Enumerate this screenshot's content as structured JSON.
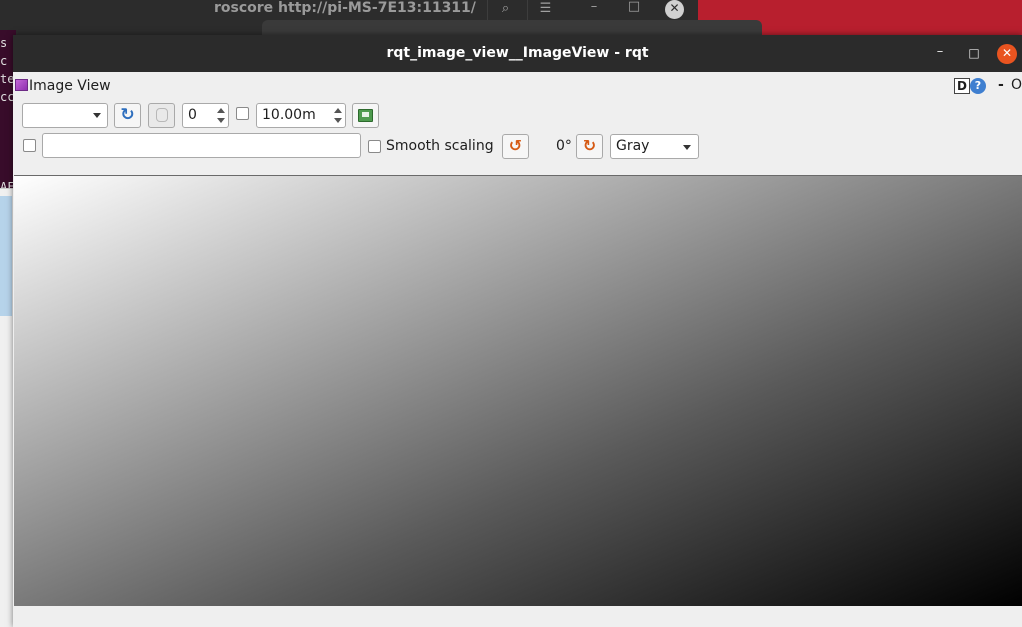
{
  "background_window": {
    "title": "roscore http://pi-MS-7E13:11311/",
    "search_icon": "search-icon",
    "menu_icon": "hamburger-menu-icon",
    "terminal_text": "s\nc\nte\ncc\n\n\n\n\nAF"
  },
  "window": {
    "title": "rqt_image_view__ImageView - rqt",
    "controls": {
      "minimize": "–",
      "maximize": "□",
      "close": "✕"
    }
  },
  "dock": {
    "title": "Image View",
    "help_d": "D",
    "help_q": "?",
    "dash": "-",
    "close_partial": "O"
  },
  "toolbar": {
    "topic_combo_value": "",
    "refresh_glyph": "↻",
    "index_value": "0",
    "timeout_checked": false,
    "timeout_value": "10.00m",
    "topic_checked": false,
    "topic_text_value": "",
    "smooth_checked": false,
    "smooth_label": "Smooth scaling",
    "rotate_left_glyph": "↺",
    "rotation_value": "0°",
    "rotate_right_glyph": "↻",
    "colormap_value": "Gray"
  },
  "image": {
    "description_colors": {
      "start": "#ffffff",
      "mid": "#9a9a9a",
      "end": "#000000"
    }
  }
}
